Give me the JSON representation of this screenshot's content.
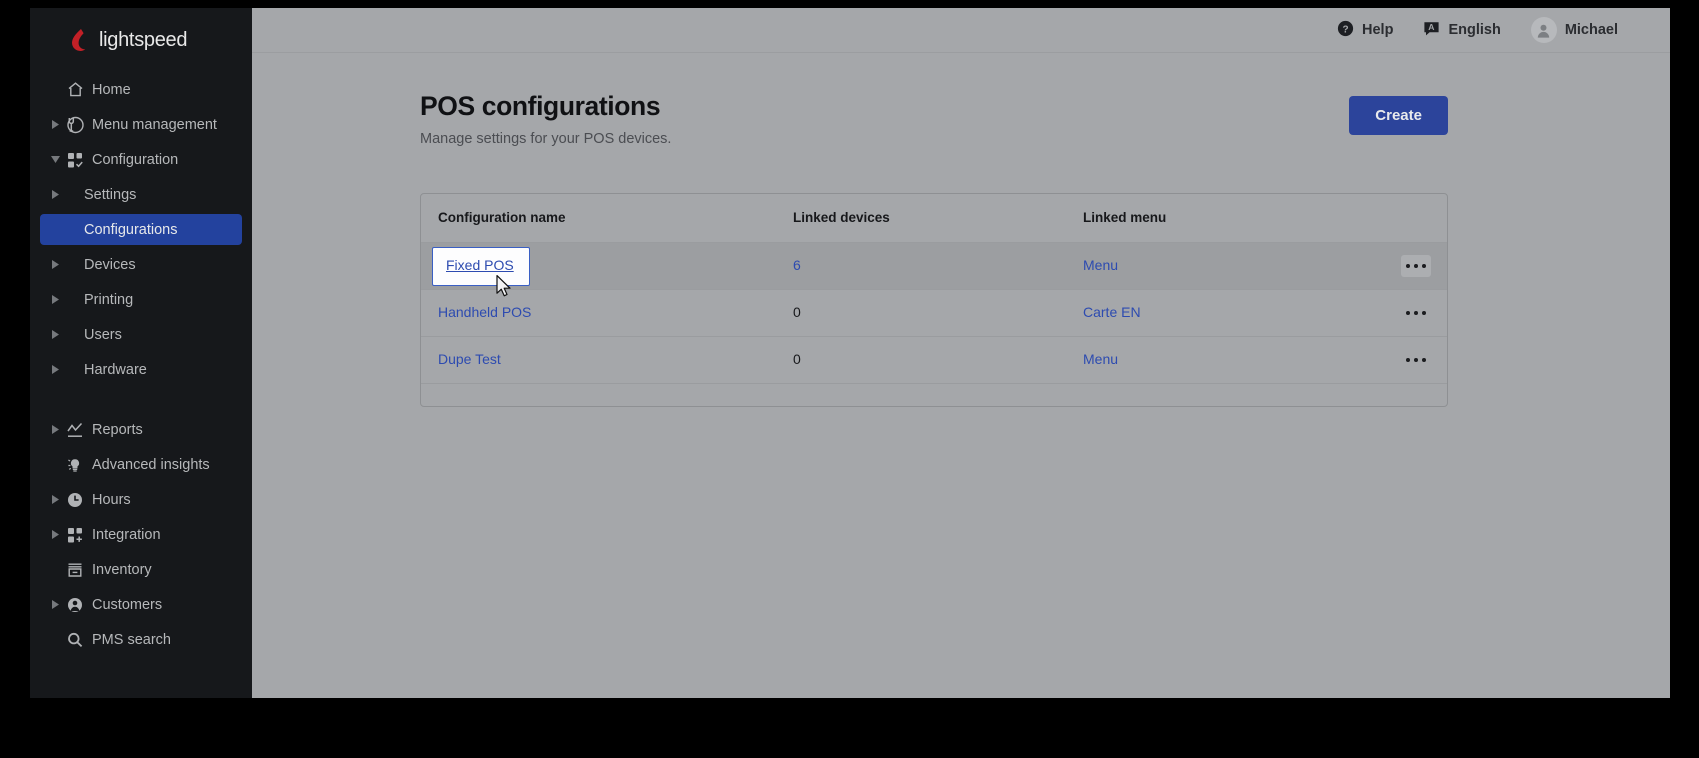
{
  "brand": {
    "name": "lightspeed",
    "logo_icon": "flame-icon",
    "accent": "#2c449b",
    "logo_color": "#c22027"
  },
  "sidebar": {
    "items": [
      {
        "label": "Home",
        "icon": "home-icon",
        "caret": "none",
        "level": "top",
        "active": false
      },
      {
        "label": "Menu management",
        "icon": "menu-management-icon",
        "caret": "right",
        "level": "top",
        "active": false
      },
      {
        "label": "Configuration",
        "icon": "configuration-grid-check-icon",
        "caret": "down",
        "level": "top",
        "active": false
      },
      {
        "label": "Settings",
        "icon": "none",
        "caret": "right",
        "level": "sub",
        "active": false
      },
      {
        "label": "Configurations",
        "icon": "none",
        "caret": "none",
        "level": "sub",
        "active": true
      },
      {
        "label": "Devices",
        "icon": "none",
        "caret": "right",
        "level": "sub",
        "active": false
      },
      {
        "label": "Printing",
        "icon": "none",
        "caret": "right",
        "level": "sub",
        "active": false
      },
      {
        "label": "Users",
        "icon": "none",
        "caret": "right",
        "level": "sub",
        "active": false
      },
      {
        "label": "Hardware",
        "icon": "none",
        "caret": "right",
        "level": "sub",
        "active": false
      },
      {
        "label": "Reports",
        "icon": "chart-line-icon",
        "caret": "right",
        "level": "top",
        "active": false
      },
      {
        "label": "Advanced insights",
        "icon": "lightbulb-icon",
        "caret": "none",
        "level": "top",
        "active": false
      },
      {
        "label": "Hours",
        "icon": "clock-icon",
        "caret": "right",
        "level": "top",
        "active": false
      },
      {
        "label": "Integration",
        "icon": "integration-grid-plus-icon",
        "caret": "right",
        "level": "top",
        "active": false
      },
      {
        "label": "Inventory",
        "icon": "inventory-box-icon",
        "caret": "none",
        "level": "top",
        "active": false
      },
      {
        "label": "Customers",
        "icon": "person-circle-icon",
        "caret": "right",
        "level": "top",
        "active": false
      },
      {
        "label": "PMS search",
        "icon": "search-icon",
        "caret": "none",
        "level": "top",
        "active": false
      }
    ]
  },
  "topbar": {
    "help": {
      "label": "Help",
      "icon": "question-circle-icon"
    },
    "language": {
      "label": "English",
      "icon": "translate-bubble-icon"
    },
    "user": {
      "label": "Michael",
      "icon": "avatar-icon"
    }
  },
  "page": {
    "title": "POS configurations",
    "subtitle": "Manage settings for your POS devices.",
    "create_label": "Create"
  },
  "table": {
    "columns": [
      "Configuration name",
      "Linked devices",
      "Linked menu"
    ],
    "row_menu_icon": "ellipsis-horizontal-icon",
    "rows": [
      {
        "name": "Fixed POS",
        "devices": "6",
        "menu": "Menu",
        "devices_is_link": true,
        "focused": true,
        "hovered": true
      },
      {
        "name": "Handheld POS",
        "devices": "0",
        "menu": "Carte EN",
        "devices_is_link": false,
        "focused": false,
        "hovered": false
      },
      {
        "name": "Dupe Test",
        "devices": "0",
        "menu": "Menu",
        "devices_is_link": false,
        "focused": false,
        "hovered": false
      }
    ]
  },
  "cursor": {
    "icon": "mouse-pointer-icon"
  }
}
